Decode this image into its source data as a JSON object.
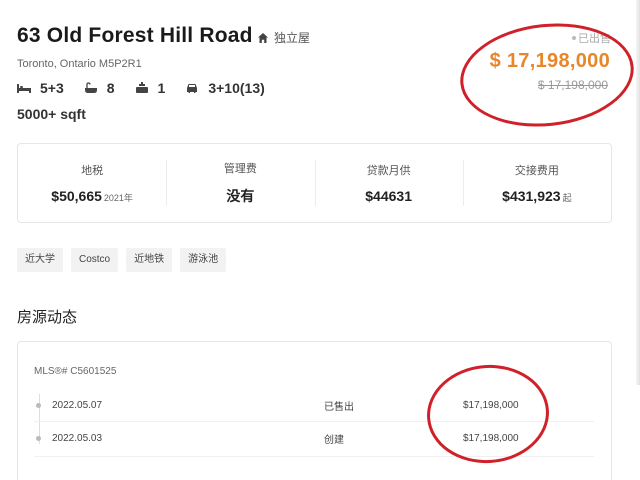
{
  "listing": {
    "address": "63 Old Forest Hill Road",
    "property_type": "独立屋",
    "city": "Toronto, Ontario M5P2R1",
    "features": {
      "bedrooms": "5+3",
      "bathrooms": "8",
      "kitchens": "1",
      "parking": "3+10(13)"
    },
    "sqft": "5000+ sqft",
    "icons": [
      "house-icon",
      "bed-icon",
      "bathtub-icon",
      "kitchen-icon",
      "car-icon"
    ]
  },
  "price": {
    "status": "已出售",
    "current": "$ 17,198,000",
    "original": "$ 17,198,000",
    "color": "#e8862a"
  },
  "stats": [
    {
      "label": "地税",
      "value": "$50,665",
      "suffix": "2021年"
    },
    {
      "label": "管理费",
      "value": "没有",
      "suffix": ""
    },
    {
      "label": "贷款月供",
      "value": "$44631",
      "suffix": ""
    },
    {
      "label": "交接费用",
      "value": "$431,923",
      "suffix": "起"
    }
  ],
  "tags": [
    "近大学",
    "Costco",
    "近地铁",
    "游泳池"
  ],
  "history": {
    "section_title": "房源动态",
    "mls": "MLS®# C5601525",
    "rows": [
      {
        "date": "2022.05.07",
        "event": "已售出",
        "amount": "$17,198,000"
      },
      {
        "date": "2022.05.03",
        "event": "创建",
        "amount": "$17,198,000"
      }
    ]
  },
  "annotation_color": "#d0202a"
}
